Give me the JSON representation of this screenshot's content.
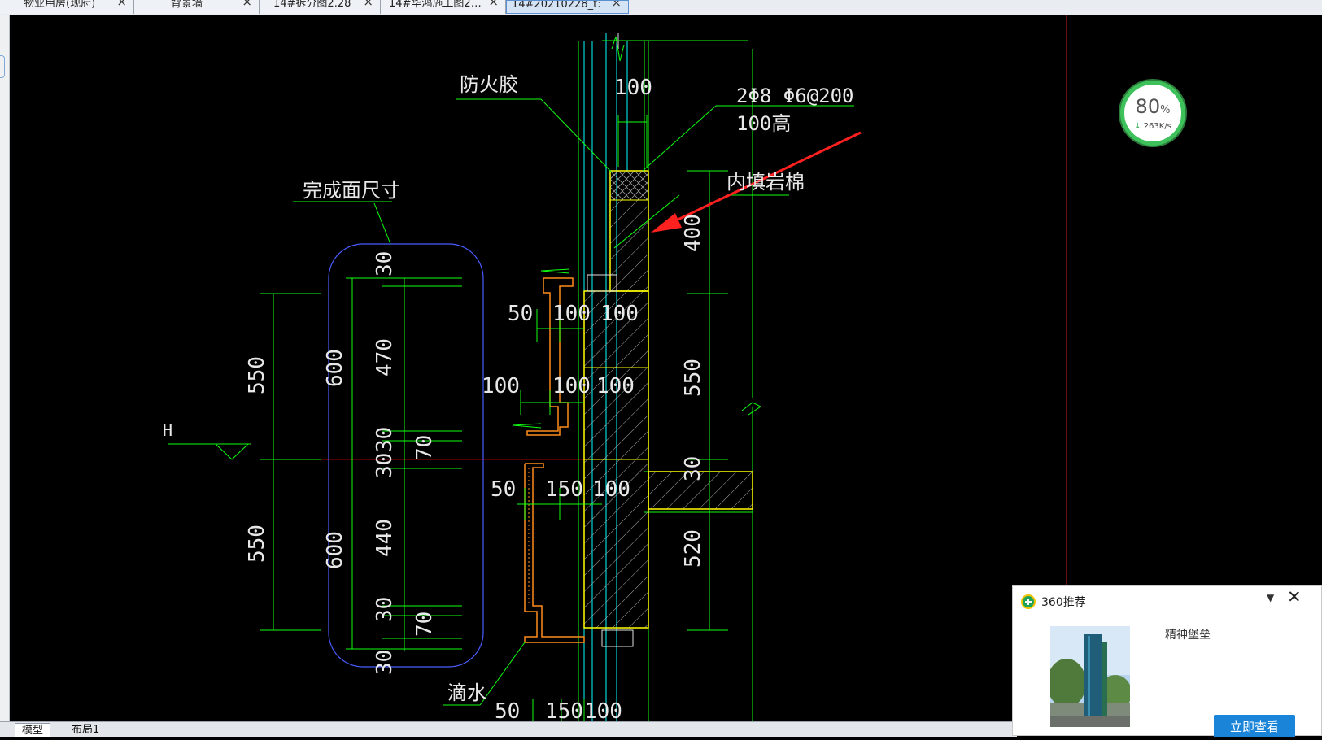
{
  "tabs": [
    {
      "label": "物业用房(现府)",
      "active": false
    },
    {
      "label": "背景墙",
      "active": false
    },
    {
      "label": "14#拆分图2.28",
      "active": false
    },
    {
      "label": "14#华鸿施工图2…",
      "active": false
    },
    {
      "label": "14#20210228_t:",
      "active": true
    }
  ],
  "drawing": {
    "annotations": {
      "fireproof_glue": "防火胶",
      "finish_size": "完成面尺寸",
      "rebar_spec": "2Φ8 Φ6@200",
      "rebar_height": "100高",
      "rock_wool": "内填岩棉",
      "drip": "滴水",
      "level_mark": "H"
    },
    "dimensions": {
      "top_100": "100",
      "a_30": "30",
      "a_470": "470",
      "a_30b": "30",
      "a_30c": "30",
      "a_440": "440",
      "a_30d": "30",
      "a_30e": "30",
      "b_600": "600",
      "b_600b": "600",
      "c_70": "70",
      "c_70b": "70",
      "d_550": "550",
      "d_550b": "550",
      "e_50": "50",
      "e_100": "100",
      "e_100b": "100",
      "f_100": "100",
      "f_100b": "100",
      "f_100c": "100",
      "g_50": "50",
      "g_150": "150",
      "g_100": "100",
      "h_50": "50",
      "h_150": "150",
      "h_100": "100",
      "r_400": "400",
      "r_550": "550",
      "r_30": "30",
      "r_520": "520"
    }
  },
  "layout_tabs": [
    {
      "label": "模型",
      "active": true
    },
    {
      "label": "布局1",
      "active": false
    }
  ],
  "speed_widget": {
    "percent": "80",
    "percent_unit": "%",
    "rate": "263K/s"
  },
  "popup": {
    "title": "360推荐",
    "item_title": "精神堡垒",
    "button_label": "立即查看"
  },
  "colors": {
    "green_line": "#10ff10",
    "cyan_line": "#00ffff",
    "yellow_line": "#ffff00",
    "orange_line": "#ff8c1a",
    "annotation_arrow": "#ff2020",
    "text": "#e8e8e8"
  }
}
